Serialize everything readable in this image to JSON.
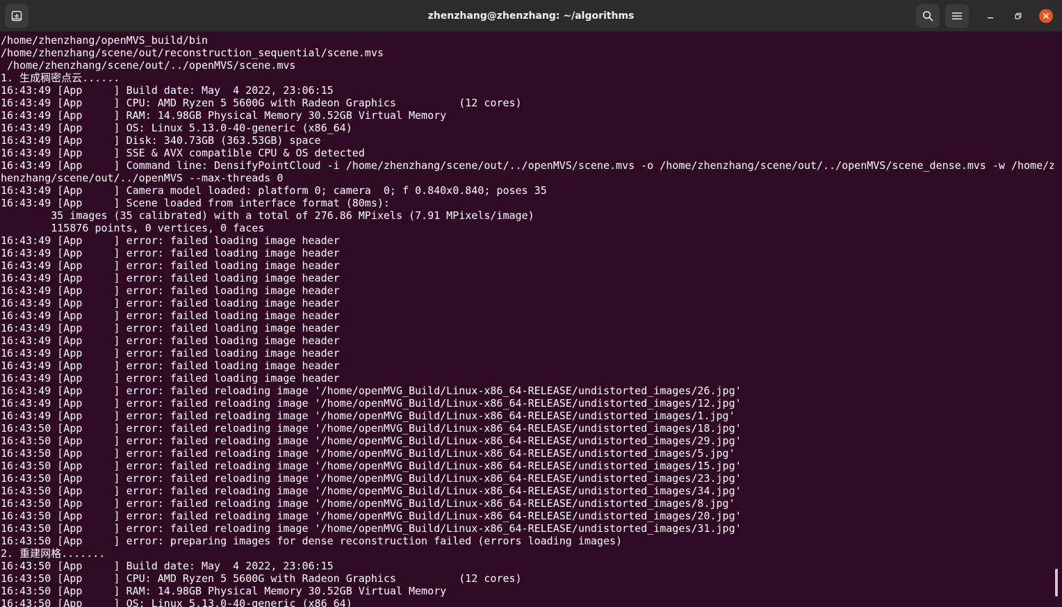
{
  "window": {
    "title": "zhenzhang@zhenzhang: ~/algorithms"
  },
  "icons": {
    "new_tab": "new-tab-icon",
    "search": "search-icon",
    "menu": "hamburger-menu-icon",
    "minimize": "minimize-icon",
    "maximize": "maximize-icon",
    "close": "close-icon"
  },
  "colors": {
    "terminal_bg": "#300a24",
    "titlebar_bg": "#2c2c2c",
    "text": "#ffffff",
    "close_button": "#e95420"
  },
  "terminal": {
    "lines": [
      "/home/zhenzhang/openMVS_build/bin",
      "/home/zhenzhang/scene/out/reconstruction_sequential/scene.mvs",
      " /home/zhenzhang/scene/out/../openMVS/scene.mvs",
      "1. 生成稠密点云......",
      "16:43:49 [App     ] Build date: May  4 2022, 23:06:15",
      "16:43:49 [App     ] CPU: AMD Ryzen 5 5600G with Radeon Graphics          (12 cores)",
      "16:43:49 [App     ] RAM: 14.98GB Physical Memory 30.52GB Virtual Memory",
      "16:43:49 [App     ] OS: Linux 5.13.0-40-generic (x86_64)",
      "16:43:49 [App     ] Disk: 340.73GB (363.53GB) space",
      "16:43:49 [App     ] SSE & AVX compatible CPU & OS detected",
      "16:43:49 [App     ] Command line: DensifyPointCloud -i /home/zhenzhang/scene/out/../openMVS/scene.mvs -o /home/zhenzhang/scene/out/../openMVS/scene_dense.mvs -w /home/z",
      "henzhang/scene/out/../openMVS --max-threads 0",
      "16:43:49 [App     ] Camera model loaded: platform 0; camera  0; f 0.840x0.840; poses 35",
      "16:43:49 [App     ] Scene loaded from interface format (80ms):",
      "        35 images (35 calibrated) with a total of 276.86 MPixels (7.91 MPixels/image)",
      "        115876 points, 0 vertices, 0 faces",
      "16:43:49 [App     ] error: failed loading image header",
      "16:43:49 [App     ] error: failed loading image header",
      "16:43:49 [App     ] error: failed loading image header",
      "16:43:49 [App     ] error: failed loading image header",
      "16:43:49 [App     ] error: failed loading image header",
      "16:43:49 [App     ] error: failed loading image header",
      "16:43:49 [App     ] error: failed loading image header",
      "16:43:49 [App     ] error: failed loading image header",
      "16:43:49 [App     ] error: failed loading image header",
      "16:43:49 [App     ] error: failed loading image header",
      "16:43:49 [App     ] error: failed loading image header",
      "16:43:49 [App     ] error: failed loading image header",
      "16:43:49 [App     ] error: failed reloading image '/home/openMVG_Build/Linux-x86_64-RELEASE/undistorted_images/26.jpg'",
      "16:43:49 [App     ] error: failed reloading image '/home/openMVG_Build/Linux-x86_64-RELEASE/undistorted_images/12.jpg'",
      "16:43:49 [App     ] error: failed reloading image '/home/openMVG_Build/Linux-x86_64-RELEASE/undistorted_images/1.jpg'",
      "16:43:50 [App     ] error: failed reloading image '/home/openMVG_Build/Linux-x86_64-RELEASE/undistorted_images/18.jpg'",
      "16:43:50 [App     ] error: failed reloading image '/home/openMVG_Build/Linux-x86_64-RELEASE/undistorted_images/29.jpg'",
      "16:43:50 [App     ] error: failed reloading image '/home/openMVG_Build/Linux-x86_64-RELEASE/undistorted_images/5.jpg'",
      "16:43:50 [App     ] error: failed reloading image '/home/openMVG_Build/Linux-x86_64-RELEASE/undistorted_images/15.jpg'",
      "16:43:50 [App     ] error: failed reloading image '/home/openMVG_Build/Linux-x86_64-RELEASE/undistorted_images/23.jpg'",
      "16:43:50 [App     ] error: failed reloading image '/home/openMVG_Build/Linux-x86_64-RELEASE/undistorted_images/34.jpg'",
      "16:43:50 [App     ] error: failed reloading image '/home/openMVG_Build/Linux-x86_64-RELEASE/undistorted_images/8.jpg'",
      "16:43:50 [App     ] error: failed reloading image '/home/openMVG_Build/Linux-x86_64-RELEASE/undistorted_images/20.jpg'",
      "16:43:50 [App     ] error: failed reloading image '/home/openMVG_Build/Linux-x86_64-RELEASE/undistorted_images/31.jpg'",
      "16:43:50 [App     ] error: preparing images for dense reconstruction failed (errors loading images)",
      "2. 重建网格.......",
      "16:43:50 [App     ] Build date: May  4 2022, 23:06:15",
      "16:43:50 [App     ] CPU: AMD Ryzen 5 5600G with Radeon Graphics          (12 cores)",
      "16:43:50 [App     ] RAM: 14.98GB Physical Memory 30.52GB Virtual Memory",
      "16:43:50 [App     ] OS: Linux 5.13.0-40-generic (x86_64)"
    ]
  }
}
